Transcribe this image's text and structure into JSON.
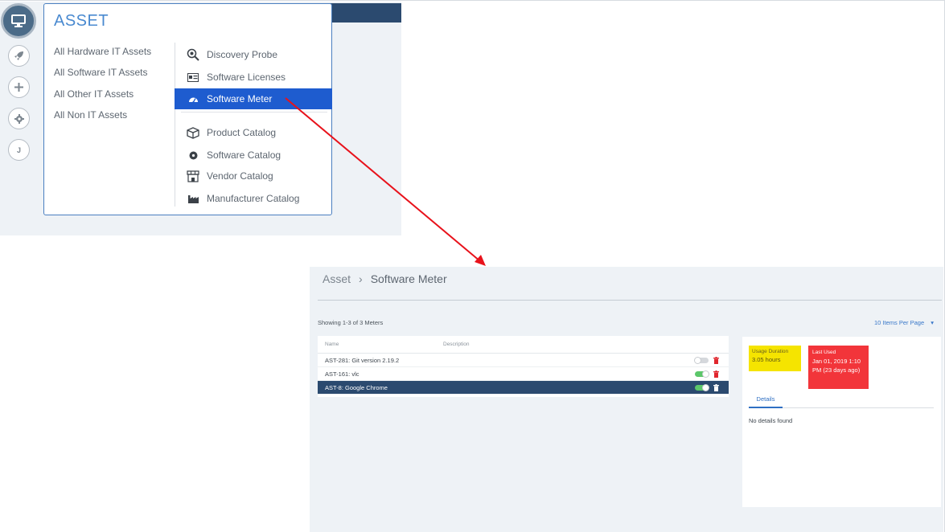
{
  "menu": {
    "title": "ASSET",
    "left_links": [
      {
        "label": "All Hardware IT Assets"
      },
      {
        "label": "All Software IT Assets"
      },
      {
        "label": "All Other IT Assets"
      },
      {
        "label": "All Non IT Assets"
      }
    ],
    "right_items": [
      {
        "label": "Discovery Probe",
        "icon": "probe-magnifier-icon"
      },
      {
        "label": "Software Licenses",
        "icon": "license-card-icon"
      },
      {
        "label": "Software Meter",
        "icon": "speedometer-icon",
        "active": true
      },
      {
        "label": "Product Catalog",
        "icon": "box-icon"
      },
      {
        "label": "Software Catalog",
        "icon": "disc-icon"
      },
      {
        "label": "Vendor Catalog",
        "icon": "store-icon"
      },
      {
        "label": "Manufacturer Catalog",
        "icon": "factory-icon"
      }
    ]
  },
  "rail": {
    "items": [
      {
        "icon": "monitor-icon",
        "active": true
      },
      {
        "icon": "rocket-icon"
      },
      {
        "icon": "plus-icon"
      },
      {
        "icon": "gear-icon"
      },
      {
        "icon": "user-initial-icon",
        "label": "J"
      }
    ]
  },
  "page": {
    "breadcrumb_root": "Asset",
    "breadcrumb_sep": "›",
    "breadcrumb_current": "Software Meter",
    "showing": "Showing 1-3 of 3 Meters",
    "per_page": "10 Items Per Page",
    "columns": {
      "name": "Name",
      "description": "Description"
    },
    "rows": [
      {
        "name": "AST-281: Git version 2.19.2",
        "enabled": false,
        "selected": false
      },
      {
        "name": "AST-161: vlc",
        "enabled": true,
        "selected": false
      },
      {
        "name": "AST-8: Google Chrome",
        "enabled": true,
        "selected": true
      }
    ],
    "detail": {
      "usage_label": "Usage Duration",
      "usage_value": "3.05 hours",
      "last_used_label": "Last Used",
      "last_used_value": "Jan 01, 2019 1:10 PM (23 days ago)",
      "tab": "Details",
      "empty": "No details found"
    }
  },
  "colors": {
    "accent": "#1e5ccf",
    "header_bar": "#2b4a6f",
    "usage_card": "#f5e400",
    "last_used_card": "#f2353a",
    "arrow": "#e8121b"
  }
}
